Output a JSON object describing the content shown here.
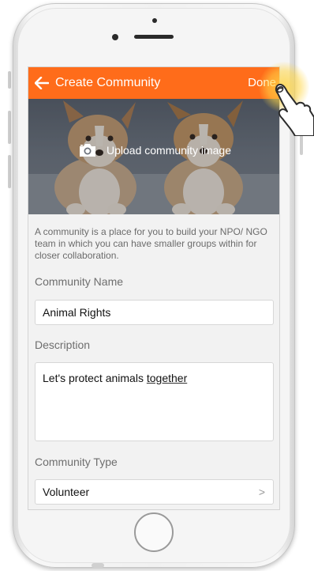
{
  "app_bar": {
    "title": "Create Community",
    "done_label": "Done",
    "back_icon": "arrow-left-icon"
  },
  "hero": {
    "upload_label": "Upload community image",
    "camera_icon": "camera-icon"
  },
  "intro": "A community is a place for you to build your NPO/ NGO team in which you can have smaller groups within for closer collaboration.",
  "form": {
    "name_label": "Community Name",
    "name_value": "Animal Rights",
    "description_label": "Description",
    "description_value_plain": "Let's protect animals ",
    "description_value_underlined": "together",
    "type_label": "Community Type",
    "type_value": "Volunteer",
    "type_chevron": ">"
  },
  "colors": {
    "accent": "#ff6c1a",
    "background": "#f2f2f2",
    "tap_highlight": "#ffd646"
  }
}
